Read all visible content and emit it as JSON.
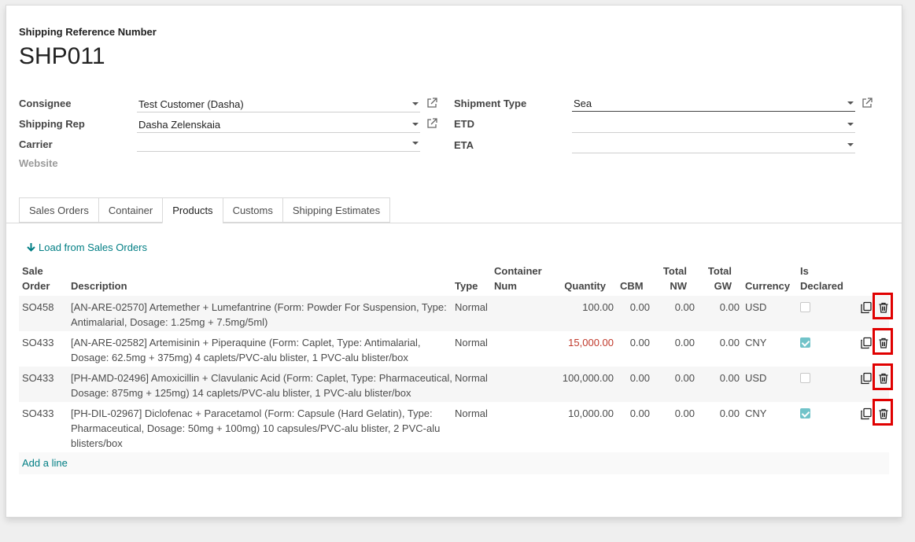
{
  "header": {
    "ref_label": "Shipping Reference Number",
    "ref_value": "SHP011"
  },
  "fields": {
    "consignee_label": "Consignee",
    "consignee_value": "Test Customer (Dasha)",
    "shipping_rep_label": "Shipping Rep",
    "shipping_rep_value": "Dasha Zelenskaia",
    "carrier_label": "Carrier",
    "carrier_value": "",
    "website_label": "Website",
    "shipment_type_label": "Shipment Type",
    "shipment_type_value": "Sea",
    "etd_label": "ETD",
    "etd_value": "",
    "eta_label": "ETA",
    "eta_value": ""
  },
  "tabs": [
    {
      "label": "Sales Orders"
    },
    {
      "label": "Container"
    },
    {
      "label": "Products"
    },
    {
      "label": "Customs"
    },
    {
      "label": "Shipping Estimates"
    }
  ],
  "products": {
    "load_label": "Load from Sales Orders",
    "columns": {
      "sale_order_1": "Sale",
      "sale_order_2": "Order",
      "description": "Description",
      "type": "Type",
      "container_1": "Container",
      "container_2": "Num",
      "quantity": "Quantity",
      "cbm": "CBM",
      "nw_1": "Total",
      "nw_2": "NW",
      "gw_1": "Total",
      "gw_2": "GW",
      "currency": "Currency",
      "declared_1": "Is",
      "declared_2": "Declared"
    },
    "rows": [
      {
        "order": "SO458",
        "desc_1": "[AN-ARE-02570] Artemether + Lumefantrine (Form: Powder For Suspension, Type:",
        "desc_2": "Antimalarial, Dosage: 1.25mg + 7.5mg/5ml)",
        "desc_3": "",
        "type": "Normal",
        "container": "",
        "quantity": "100.00",
        "cbm": "0.00",
        "nw": "0.00",
        "gw": "0.00",
        "currency": "USD",
        "declared": false
      },
      {
        "order": "SO433",
        "desc_1": "[AN-ARE-02582] Artemisinin + Piperaquine (Form: Caplet, Type: Antimalarial,",
        "desc_2": "Dosage: 62.5mg + 375mg) 4 caplets/PVC-alu blister, 1 PVC-alu blister/box",
        "desc_3": "",
        "type": "Normal",
        "container": "",
        "quantity": "15,000.00",
        "cbm": "0.00",
        "nw": "0.00",
        "gw": "0.00",
        "currency": "CNY",
        "declared": true
      },
      {
        "order": "SO433",
        "desc_1": "[PH-AMD-02496] Amoxicillin + Clavulanic Acid (Form: Caplet, Type: Pharmaceutical,",
        "desc_2": "Dosage: 875mg + 125mg) 14 caplets/PVC-alu blister, 1 PVC-alu blister/box",
        "desc_3": "",
        "type": "Normal",
        "container": "",
        "quantity": "100,000.00",
        "cbm": "0.00",
        "nw": "0.00",
        "gw": "0.00",
        "currency": "USD",
        "declared": false
      },
      {
        "order": "SO433",
        "desc_1": "[PH-DIL-02967] Diclofenac + Paracetamol (Form: Capsule (Hard Gelatin), Type:",
        "desc_2": "Pharmaceutical, Dosage: 50mg + 100mg) 10 capsules/PVC-alu blister, 2 PVC-alu",
        "desc_3": "blisters/box",
        "type": "Normal",
        "container": "",
        "quantity": "10,000.00",
        "cbm": "0.00",
        "nw": "0.00",
        "gw": "0.00",
        "currency": "CNY",
        "declared": true
      }
    ],
    "add_line_label": "Add a line"
  },
  "colors": {
    "accent": "#017e84",
    "highlight": "#e00000",
    "warning_qty": "#c0392b"
  }
}
